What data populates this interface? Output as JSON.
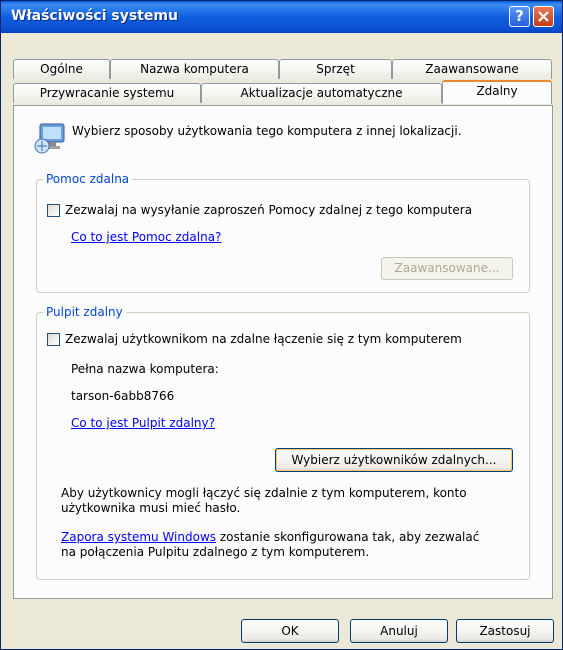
{
  "window": {
    "title": "Właściwości systemu",
    "help_glyph": "?"
  },
  "tabs_row1": [
    "Ogólne",
    "Nazwa komputera",
    "Sprzęt",
    "Zaawansowane"
  ],
  "tabs_row2": [
    "Przywracanie systemu",
    "Aktualizacje automatyczne",
    "Zdalny"
  ],
  "intro": {
    "icon": "remote-computer-icon",
    "text": "Wybierz sposoby użytkowania tego komputera z innej lokalizacji."
  },
  "remote_assistance": {
    "title": "Pomoc zdalna",
    "checkbox_label": "Zezwalaj na wysyłanie zaproszeń Pomocy zdalnej z tego komputera",
    "checked": false,
    "link": "Co to jest Pomoc zdalna?",
    "advanced_button": "Zaawansowane..."
  },
  "remote_desktop": {
    "title": "Pulpit zdalny",
    "checkbox_label": "Zezwalaj użytkownikom na zdalne łączenie się z tym komputerem",
    "checked": false,
    "computer_name_label": "Pełna nazwa komputera:",
    "computer_name": "tarson-6abb8766",
    "link": "Co to jest Pulpit zdalny?",
    "select_users_button": "Wybierz użytkowników zdalnych...",
    "note_line1": "Aby użytkownicy mogli łączyć się zdalnie z tym komputerem, konto",
    "note_line2": "użytkownika musi mieć hasło.",
    "firewall_link": "Zapora systemu Windows",
    "firewall_text_line1": " zostanie skonfigurowana tak, aby zezwalać",
    "firewall_text_line2": "na połączenia Pulpitu zdalnego z tym komputerem."
  },
  "footer": {
    "ok": "OK",
    "cancel": "Anuluj",
    "apply": "Zastosuj"
  },
  "colors": {
    "title_bar": "#0a58d8",
    "group_title": "#0046d5",
    "link": "#0000ff",
    "active_tab_accent": "#e68b2c"
  }
}
